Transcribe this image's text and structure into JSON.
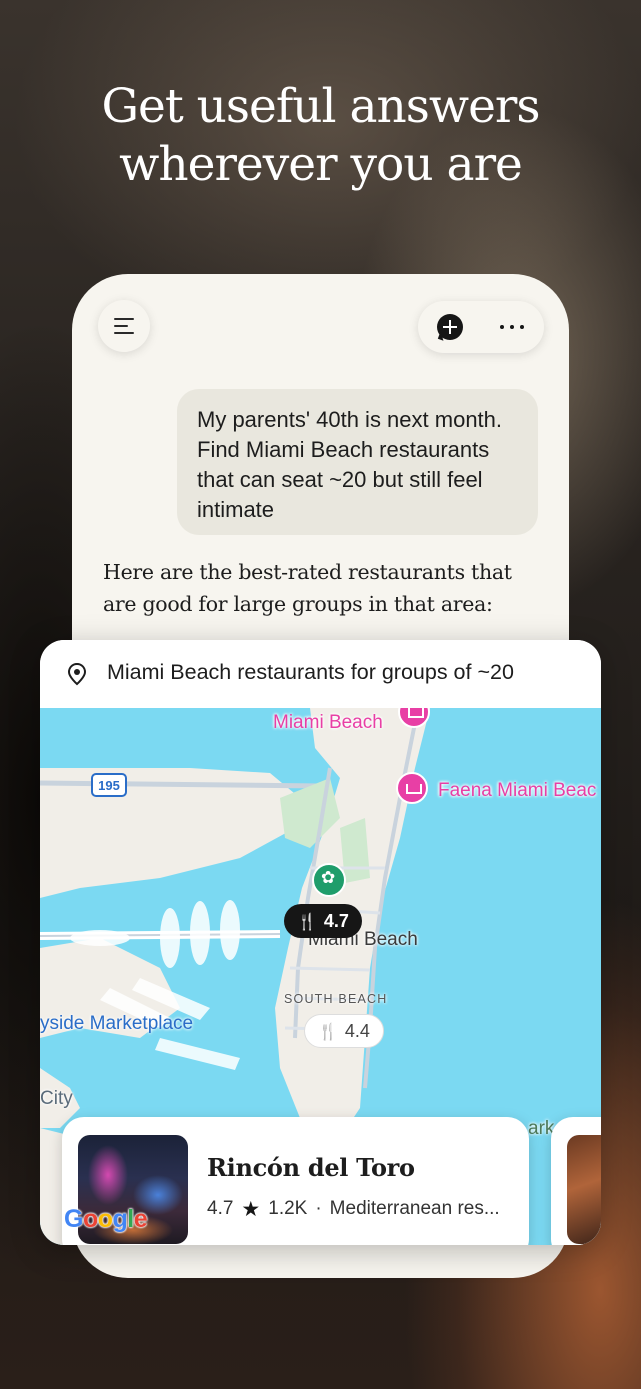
{
  "headline": {
    "line1": "Get useful answers",
    "line2": "wherever you are"
  },
  "toolbar": {
    "menu_icon": "hamburger-menu-icon",
    "new_chat_icon": "new-chat-icon",
    "more_icon": "more-horizontal-icon"
  },
  "chat": {
    "user_message": "My parents' 40th is next month. Find Miami Beach restaurants that can seat ~20 but still feel intimate",
    "assistant_message": "Here are the best-rated restaurants that are good for large groups in that area:"
  },
  "map_card": {
    "title": "Miami Beach restaurants for groups of ~20",
    "labels": {
      "miami_beach_top": "Miami Beach",
      "faena": "Faena Miami Beac",
      "miami_beach_center": "Miami Beach",
      "south_beach": "SOUTH BEACH",
      "bayside": "yside Marketplace",
      "city_fragment": "City",
      "park_fragment": "ark",
      "highway": "195"
    },
    "pins": [
      {
        "rating": "4.7",
        "selected": true
      },
      {
        "rating": "4.4",
        "selected": false
      }
    ],
    "attribution": {
      "letters": [
        "G",
        "o",
        "o",
        "g",
        "l",
        "e"
      ],
      "colors": [
        "#4285f4",
        "#ea4335",
        "#fbbc05",
        "#4285f4",
        "#34a853",
        "#ea4335"
      ]
    }
  },
  "place": {
    "name": "Rincón del Toro",
    "rating": "4.7",
    "reviews": "1.2K",
    "separator": "·",
    "category": "Mediterranean res..."
  },
  "colors": {
    "phone_bg": "#f7f5ef",
    "bubble_bg": "#e9e7de",
    "water": "#7bd9f2",
    "poi_pink": "#e83fa5",
    "pin_green": "#1f9d6b"
  }
}
